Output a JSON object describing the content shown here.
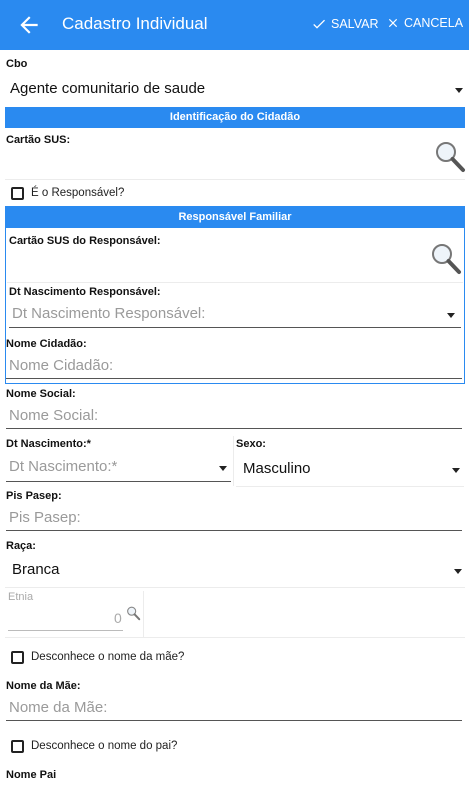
{
  "appbar": {
    "title": "Cadastro Individual",
    "save_label": "SALVAR",
    "cancel_label": "CANCELA",
    "color": "#2a8af0"
  },
  "cbo": {
    "label": "Cbo",
    "value": "Agente comunitario de saude"
  },
  "identificacao": {
    "header": "Identificação do Cidadão",
    "cartao_sus_label": "Cartão SUS:",
    "is_responsavel_label": "É o Responsável?",
    "is_responsavel_checked": false
  },
  "responsavel": {
    "header": "Responsável Familiar",
    "cartao_label": "Cartão SUS do Responsável:",
    "dt_label": "Dt Nascimento Responsável:",
    "dt_placeholder": "Dt Nascimento Responsável:"
  },
  "nome_cidadao": {
    "label": "Nome Cidadão:",
    "placeholder": "Nome Cidadão:"
  },
  "nome_social": {
    "label": "Nome Social:",
    "placeholder": "Nome Social:"
  },
  "dt_nascimento": {
    "label": "Dt Nascimento:*",
    "placeholder": "Dt Nascimento:*"
  },
  "sexo": {
    "label": "Sexo:",
    "value": "Masculino"
  },
  "pis_pasep": {
    "label": "Pis Pasep:",
    "placeholder": "Pis Pasep:"
  },
  "raca": {
    "label": "Raça:",
    "value": "Branca"
  },
  "etnia": {
    "label": "Etnia",
    "value": "0"
  },
  "mae": {
    "unknown_label": "Desconhece o nome da mãe?",
    "unknown_checked": false,
    "label": "Nome da Mãe:",
    "placeholder": "Nome da Mãe:"
  },
  "pai": {
    "unknown_label": "Desconhece o nome do pai?",
    "unknown_checked": false,
    "label": "Nome Pai"
  }
}
